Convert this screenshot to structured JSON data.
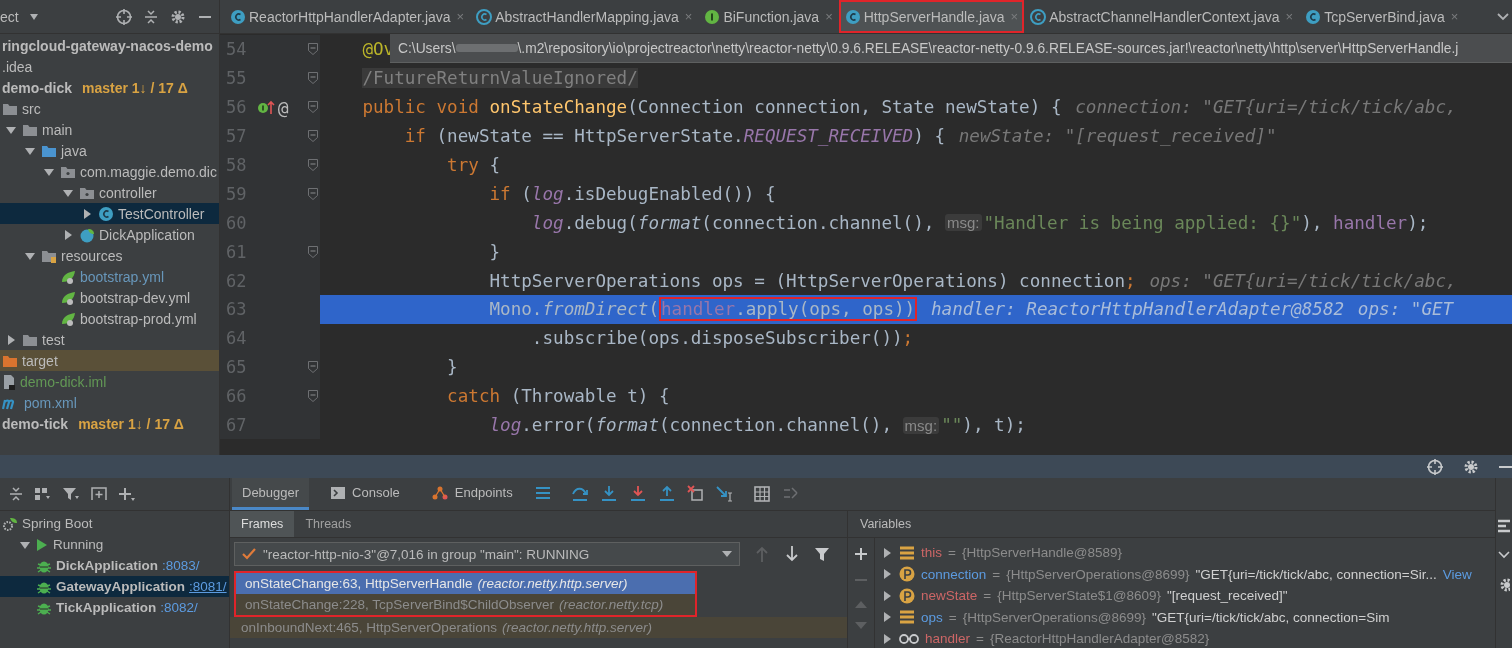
{
  "project_panel": {
    "title": "ect",
    "tree": [
      {
        "label": "ringcloud-gateway-nacos-demo",
        "kind": "module"
      },
      {
        "label": ".idea",
        "kind": "none"
      },
      {
        "label": "demo-dick",
        "kind": "module",
        "branch": "master 1↓ / 17 Δ"
      },
      {
        "label": "src",
        "kind": "folder",
        "children": [
          {
            "label": "main",
            "kind": "folder",
            "expanded": true,
            "children": [
              {
                "label": "java",
                "kind": "source-folder",
                "expanded": true,
                "children": [
                  {
                    "label": "com.maggie.demo.dic",
                    "kind": "package",
                    "expanded": true,
                    "children": [
                      {
                        "label": "controller",
                        "kind": "package",
                        "expanded": true,
                        "children": [
                          {
                            "label": "TestController",
                            "kind": "class",
                            "expanded": false,
                            "selected": true
                          }
                        ]
                      },
                      {
                        "label": "DickApplication",
                        "kind": "spring-class",
                        "expanded": false
                      }
                    ]
                  }
                ]
              },
              {
                "label": "resources",
                "kind": "resource-folder",
                "expanded": true,
                "children": [
                  {
                    "label": "bootstrap.yml",
                    "kind": "yml",
                    "color": "#6897bb"
                  },
                  {
                    "label": "bootstrap-dev.yml",
                    "kind": "yml"
                  },
                  {
                    "label": "bootstrap-prod.yml",
                    "kind": "yml"
                  }
                ]
              }
            ]
          },
          {
            "label": "test",
            "kind": "folder",
            "expanded": false
          }
        ]
      },
      {
        "label": "target",
        "kind": "excluded-folder",
        "excluded": true
      },
      {
        "label": "demo-dick.iml",
        "kind": "file",
        "color": "#629755"
      },
      {
        "label": "pom.xml",
        "kind": "maven",
        "color": "#6897bb"
      },
      {
        "label": "demo-tick",
        "kind": "module",
        "branch": "master 1↓ / 17 Δ"
      }
    ]
  },
  "editor_tabs": [
    {
      "label": "ReactorHttpHandlerAdapter.java",
      "kind": "class",
      "selected": false,
      "outlined": false,
      "close": "×"
    },
    {
      "label": "AbstractHandlerMapping.java",
      "kind": "abstract-class",
      "selected": false,
      "outlined": false,
      "close": "×"
    },
    {
      "label": "BiFunction.java",
      "kind": "interface",
      "selected": false,
      "outlined": false,
      "close": "×"
    },
    {
      "label": "HttpServerHandle.java",
      "kind": "class",
      "selected": true,
      "outlined": true,
      "close": "×"
    },
    {
      "label": "AbstractChannelHandlerContext.java",
      "kind": "abstract-class",
      "selected": false,
      "outlined": false,
      "close": "×"
    },
    {
      "label": "TcpServerBind.java",
      "kind": "class",
      "selected": false,
      "outlined": false,
      "close": "×"
    }
  ],
  "editor": {
    "path_tooltip": {
      "start": "C:\\Users\\",
      "end": "\\.m2\\repository\\io\\projectreactor\\netty\\reactor-netty\\0.9.6.RELEASE\\reactor-netty-0.9.6.RELEASE-sources.jar!\\reactor\\netty\\http\\server\\HttpServerHandle.j"
    },
    "lines": [
      {
        "number": "54",
        "fold": true,
        "current": false,
        "tokens": [
          {
            "kind": "annotation",
            "text": "    @Ov"
          }
        ]
      },
      {
        "number": "55",
        "fold": true,
        "current": false,
        "tokens": [
          {
            "kind": "comment",
            "text": "    /FutureReturnValueIgnored/"
          }
        ]
      },
      {
        "number": "56",
        "fold": true,
        "current": false,
        "gutter_icons": [
          {
            "kind": "implementation"
          }
        ],
        "gutter_text": "@",
        "tokens": [
          {
            "kind": "keyword",
            "text": "    public void "
          },
          {
            "kind": "declaration",
            "text": "onStateChange"
          },
          {
            "kind": "plain",
            "text": "(Connection connection, State newState) {"
          },
          {
            "kind": "hint",
            "text": "connection: \"GET{uri=/tick/tick/abc,"
          }
        ]
      },
      {
        "number": "57",
        "fold": true,
        "current": false,
        "tokens": [
          {
            "kind": "keyword",
            "text": "        if "
          },
          {
            "kind": "plain",
            "text": "(newState == HttpServerState."
          },
          {
            "kind": "constant",
            "text": "REQUEST_RECEIVED"
          },
          {
            "kind": "plain",
            "text": ") {"
          },
          {
            "kind": "hint",
            "text": "newState: \"[request_received]\""
          }
        ]
      },
      {
        "number": "58",
        "fold": true,
        "current": false,
        "tokens": [
          {
            "kind": "keyword",
            "text": "            try "
          },
          {
            "kind": "plain",
            "text": "{"
          }
        ]
      },
      {
        "number": "59",
        "fold": true,
        "current": false,
        "tokens": [
          {
            "kind": "keyword",
            "text": "                if "
          },
          {
            "kind": "plain",
            "text": "("
          },
          {
            "kind": "static-field",
            "text": "log"
          },
          {
            "kind": "plain",
            "text": ".isDebugEnabled()) {"
          }
        ]
      },
      {
        "number": "60",
        "fold": false,
        "current": false,
        "tokens": [
          {
            "kind": "static-field",
            "text": "                    log"
          },
          {
            "kind": "plain",
            "text": ".debug("
          },
          {
            "kind": "static-call",
            "text": "format"
          },
          {
            "kind": "plain",
            "text": "(connection.channel(), "
          },
          {
            "kind": "param-hint",
            "text": "msg:"
          },
          {
            "kind": "string",
            "text": "\"Handler is being applied: {}\""
          },
          {
            "kind": "plain",
            "text": "), "
          },
          {
            "kind": "field",
            "text": "handler"
          },
          {
            "kind": "plain",
            "text": ");"
          }
        ]
      },
      {
        "number": "61",
        "fold": true,
        "current": false,
        "tokens": [
          {
            "kind": "plain",
            "text": "                }"
          }
        ]
      },
      {
        "number": "62",
        "fold": false,
        "current": false,
        "tokens": [
          {
            "kind": "plain",
            "text": "                HttpServerOperations ops = (HttpServerOperations) connection"
          },
          {
            "kind": "keyword",
            "text": ";"
          },
          {
            "kind": "hint",
            "text": "ops: \"GET{uri=/tick/tick/abc,"
          }
        ]
      },
      {
        "number": "63",
        "fold": false,
        "current": true,
        "tokens": [
          {
            "kind": "plain",
            "text": "                Mono."
          },
          {
            "kind": "static-call",
            "text": "fromDirect"
          },
          {
            "kind": "plain",
            "text": "("
          },
          {
            "kind": "field",
            "text": "handler",
            "outlined": true
          },
          {
            "kind": "plain",
            "text": ".apply(ops, ops))",
            "outlined": true
          },
          {
            "kind": "hint",
            "text": "handler: ReactorHttpHandlerAdapter@8582"
          },
          {
            "kind": "hint",
            "text": "ops: \"GET"
          }
        ]
      },
      {
        "number": "64",
        "fold": false,
        "current": false,
        "tokens": [
          {
            "kind": "plain",
            "text": "                    .subscribe(ops.disposeSubscriber())"
          },
          {
            "kind": "keyword",
            "text": ";"
          }
        ]
      },
      {
        "number": "65",
        "fold": true,
        "current": false,
        "tokens": [
          {
            "kind": "plain",
            "text": "            }"
          }
        ]
      },
      {
        "number": "66",
        "fold": true,
        "current": false,
        "tokens": [
          {
            "kind": "keyword",
            "text": "            catch "
          },
          {
            "kind": "plain",
            "text": "(Throwable t) {"
          }
        ]
      },
      {
        "number": "67",
        "fold": false,
        "current": false,
        "tokens": [
          {
            "kind": "static-field",
            "text": "                log"
          },
          {
            "kind": "plain",
            "text": ".error("
          },
          {
            "kind": "static-call",
            "text": "format"
          },
          {
            "kind": "plain",
            "text": "(connection.channel(), "
          },
          {
            "kind": "param-hint",
            "text": "msg:"
          },
          {
            "kind": "string",
            "text": "\"\""
          },
          {
            "kind": "plain",
            "text": "), t);"
          }
        ]
      }
    ]
  },
  "services": {
    "tree": [
      {
        "label": "Spring Boot",
        "kind": "spring",
        "children": [
          {
            "label": "Running",
            "kind": "running",
            "expanded": true,
            "children": [
              {
                "label": "DickApplication",
                "port": ":8083/",
                "kind": "app",
                "selected": false
              },
              {
                "label": "GatewayApplication",
                "port": ":8081/",
                "kind": "app",
                "selected": true
              },
              {
                "label": "TickApplication",
                "port": ":8082/",
                "kind": "app",
                "selected": false
              }
            ]
          }
        ]
      }
    ]
  },
  "debugger": {
    "tabs": [
      {
        "label": "Debugger",
        "kind": "debugger",
        "selected": true
      },
      {
        "label": "Console",
        "kind": "console",
        "selected": false
      },
      {
        "label": "Endpoints",
        "kind": "endpoints",
        "selected": false
      }
    ],
    "subtabs": [
      {
        "label": "Frames",
        "selected": true
      },
      {
        "label": "Threads",
        "selected": false
      }
    ],
    "thread": "\"reactor-http-nio-3\"@7,016 in group \"main\": RUNNING",
    "frames": [
      {
        "location": "onStateChange:63, HttpServerHandle",
        "package": "(reactor.netty.http.server)",
        "selected": true,
        "library": false,
        "outlined": true
      },
      {
        "location": "onStateChange:228, TcpServerBind$ChildObserver",
        "package": "(reactor.netty.tcp)",
        "selected": false,
        "library": true,
        "outlined": true
      },
      {
        "location": "onInboundNext:465, HttpServerOperations",
        "package": "(reactor.netty.http.server)",
        "selected": false,
        "library": true,
        "outlined": false
      }
    ]
  },
  "variables": {
    "title": "Variables",
    "items": [
      {
        "name": "this",
        "kind": "field",
        "color": "#cc6666",
        "separator": "=",
        "type_value": "{HttpServerHandle@8589}"
      },
      {
        "name": "connection",
        "kind": "parameter",
        "color": "#5c9be0",
        "separator": "=",
        "type_value": "{HttpServerOperations@8699}",
        "value": "\"GET{uri=/tick/tick/abc, connection=Sir...",
        "link": "View"
      },
      {
        "name": "newState",
        "kind": "parameter",
        "color": "#cc6666",
        "separator": "=",
        "type_value": "{HttpServerState$1@8609}",
        "value": "\"[request_received]\""
      },
      {
        "name": "ops",
        "kind": "field",
        "color": "#5c9be0",
        "separator": "=",
        "type_value": "{HttpServerOperations@8699}",
        "value": "\"GET{uri=/tick/tick/abc, connection=Sim"
      },
      {
        "name": "handler",
        "kind": "watch",
        "color": "#cc6666",
        "separator": "=",
        "type_value": "{ReactorHttpHandlerAdapter@8582}"
      }
    ]
  }
}
